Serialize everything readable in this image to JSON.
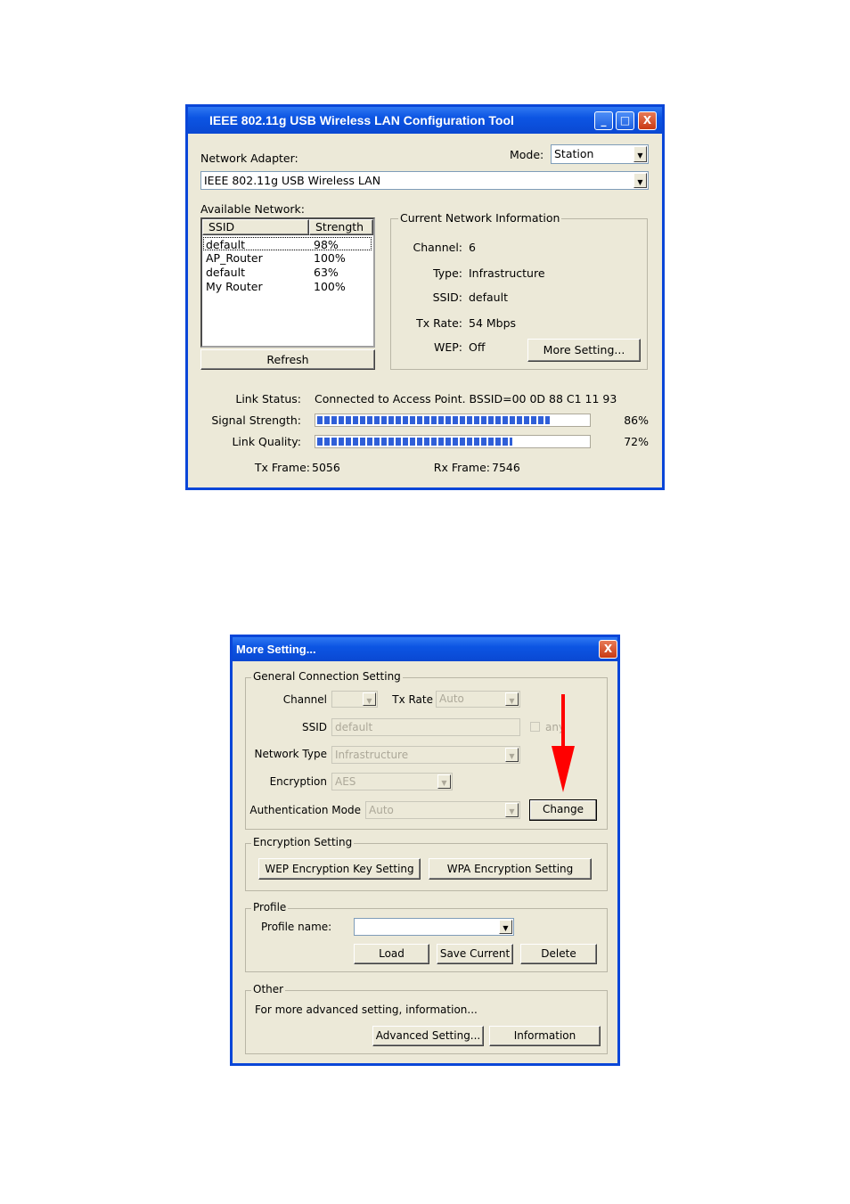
{
  "main_window": {
    "title": "IEEE 802.11g USB Wireless LAN Configuration Tool",
    "controls": {
      "minimize": "_",
      "maximize": "□",
      "close": "X"
    },
    "network_adapter_label": "Network Adapter:",
    "adapter_value": "IEEE 802.11g USB Wireless LAN",
    "mode_label": "Mode:",
    "mode_value": "Station",
    "available_network_label": "Available Network:",
    "list_headers": {
      "ssid": "SSID",
      "strength": "Strength"
    },
    "networks": [
      {
        "ssid": "default",
        "strength": "98%"
      },
      {
        "ssid": "AP_Router",
        "strength": "100%"
      },
      {
        "ssid": "default",
        "strength": "63%"
      },
      {
        "ssid": "My Router",
        "strength": "100%"
      }
    ],
    "refresh_label": "Refresh",
    "current_info": {
      "title": "Current Network Information",
      "channel_label": "Channel:",
      "channel_value": "6",
      "type_label": "Type:",
      "type_value": "Infrastructure",
      "ssid_label": "SSID:",
      "ssid_value": "default",
      "txrate_label": "Tx Rate:",
      "txrate_value": "54 Mbps",
      "wep_label": "WEP:",
      "wep_value": "Off",
      "more_setting_label": "More Setting..."
    },
    "link_status_label": "Link Status:",
    "link_status_value": "Connected to Access Point. BSSID=00 0D 88 C1 11 93",
    "signal_label": "Signal Strength:",
    "signal_value": "86%",
    "signal_percent": 86,
    "quality_label": "Link Quality:",
    "quality_value": "72%",
    "quality_percent": 72,
    "tx_frame_label": "Tx Frame:",
    "tx_frame_value": "5056",
    "rx_frame_label": "Rx Frame:",
    "rx_frame_value": "7546"
  },
  "more_window": {
    "title": "More Setting...",
    "close": "X",
    "general": {
      "title": "General Connection Setting",
      "channel_label": "Channel",
      "channel_value": "",
      "txrate_label": "Tx Rate",
      "txrate_value": "Auto",
      "ssid_label": "SSID",
      "ssid_value": "default",
      "any_label": "any",
      "network_type_label": "Network Type",
      "network_type_value": "Infrastructure",
      "encryption_label": "Encryption",
      "encryption_value": "AES",
      "auth_mode_label": "Authentication Mode",
      "auth_mode_value": "Auto",
      "change_label": "Change"
    },
    "encryption_setting": {
      "title": "Encryption Setting",
      "wep_button": "WEP Encryption Key Setting",
      "wpa_button": "WPA Encryption Setting"
    },
    "profile": {
      "title": "Profile",
      "name_label": "Profile name:",
      "name_value": "",
      "load": "Load",
      "save_current": "Save Current",
      "delete": "Delete"
    },
    "other": {
      "title": "Other",
      "description": "For more advanced setting, information...",
      "advanced": "Advanced Setting...",
      "information": "Information"
    }
  },
  "colors": {
    "title_blue": "#0a46d8",
    "face": "#ece9d8",
    "arrow_red": "#ff0000",
    "progress": "#2f5fd8"
  }
}
